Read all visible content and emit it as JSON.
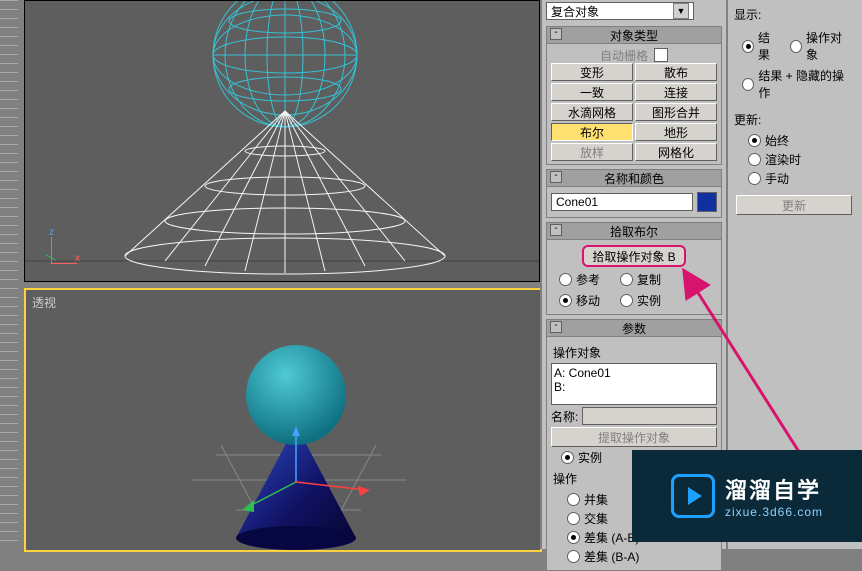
{
  "viewport": {
    "bottom_label": "透视"
  },
  "dropdown": {
    "compound_objects": "复合对象"
  },
  "rollouts": {
    "object_type": {
      "title": "对象类型",
      "autogrid_label": "自动栅格",
      "buttons": {
        "morph": "变形",
        "scatter": "散布",
        "conform": "一致",
        "connect": "连接",
        "blobmesh": "水滴网格",
        "shapemerge": "图形合并",
        "boolean": "布尔",
        "terrain": "地形",
        "loft": "放样",
        "mesher": "网格化"
      }
    },
    "name_color": {
      "title": "名称和颜色",
      "name_value": "Cone01",
      "swatch_color": "#1030a0"
    },
    "pick_boolean": {
      "title": "拾取布尔",
      "pick_button": "拾取操作对象 B",
      "reference": "参考",
      "copy": "复制",
      "move": "移动",
      "instance": "实例"
    },
    "parameters": {
      "title": "参数",
      "operands_label": "操作对象",
      "ops_list_a": "A: Cone01",
      "ops_list_b": "B:",
      "name_label": "名称:",
      "name_value": "",
      "extract_btn": "提取操作对象",
      "instance": "实例",
      "operation_label": "操作",
      "union": "并集",
      "intersection": "交集",
      "sub_ab": "差集 (A-B)",
      "sub_ba": "差集 (B-A)"
    }
  },
  "right_panel": {
    "display": {
      "title": "显示:",
      "result": "结果",
      "operands": "操作对象",
      "result_hidden": "结果 + 隐藏的操作"
    },
    "update": {
      "title": "更新:",
      "always": "始终",
      "render": "渲染时",
      "manual": "手动",
      "update_btn": "更新"
    }
  },
  "watermark": {
    "line1": "溜溜自学",
    "line2": "zixue.3d66.com"
  }
}
